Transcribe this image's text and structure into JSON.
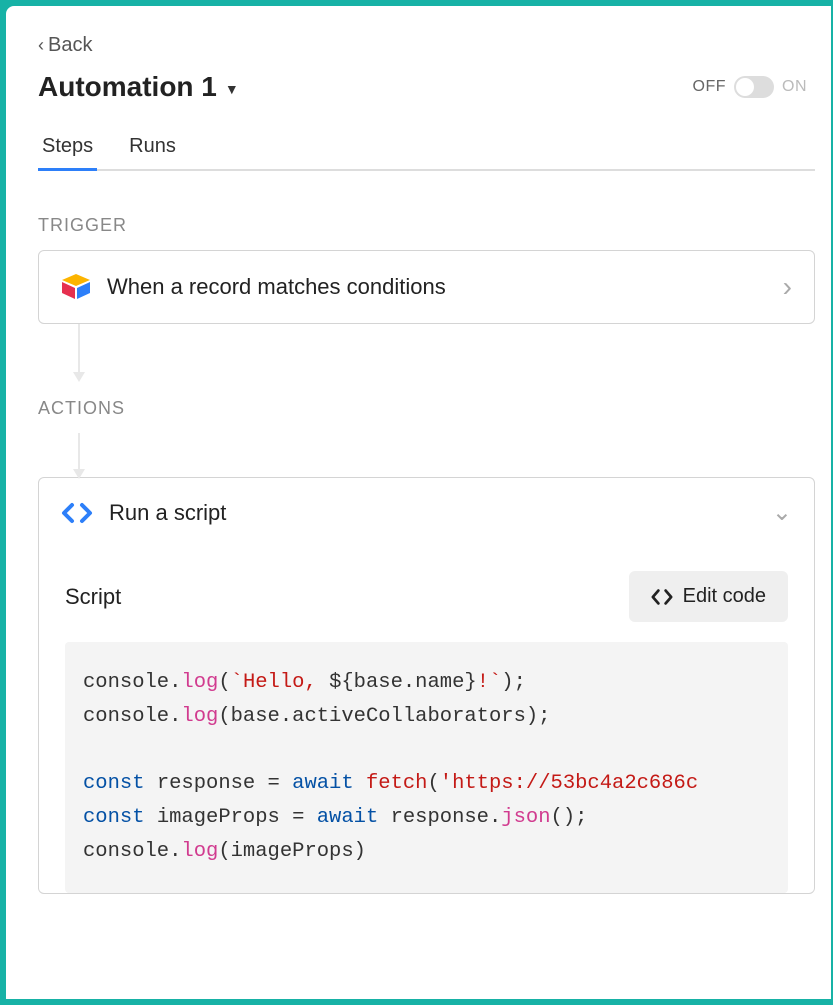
{
  "back": {
    "label": "Back"
  },
  "header": {
    "title": "Automation 1",
    "off_label": "OFF",
    "on_label": "ON"
  },
  "tabs": {
    "steps": "Steps",
    "runs": "Runs"
  },
  "trigger": {
    "section_label": "TRIGGER",
    "card_title": "When a record matches conditions"
  },
  "actions": {
    "section_label": "ACTIONS",
    "card_title": "Run a script",
    "script_label": "Script",
    "edit_code_label": "Edit code",
    "code": {
      "line1_a": "console.",
      "line1_b": "log",
      "line1_c": "(",
      "line1_d": "`Hello, ",
      "line1_e": "${base.name}",
      "line1_f": "!`",
      "line1_g": ");",
      "line2_a": "console.",
      "line2_b": "log",
      "line2_c": "(base.activeCollaborators);",
      "line4_a": "const",
      "line4_b": " response = ",
      "line4_c": "await",
      "line4_d": " ",
      "line4_e": "fetch",
      "line4_f": "(",
      "line4_g": "'https://53bc4a2c686c",
      "line5_a": "const",
      "line5_b": " imageProps = ",
      "line5_c": "await",
      "line5_d": " response.",
      "line5_e": "json",
      "line5_f": "();",
      "line6_a": "console.",
      "line6_b": "log",
      "line6_c": "(imageProps)"
    }
  }
}
